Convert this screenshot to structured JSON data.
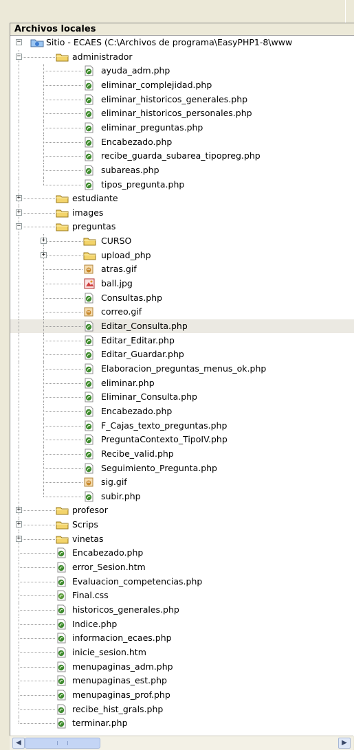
{
  "window": {
    "panel_title": "Archivos locales"
  },
  "tree": [
    {
      "label": "Sitio - ECAES (C:\\Archivos de programa\\EasyPHP1-8\\www",
      "type": "site",
      "depth": 0,
      "expander": "minus"
    },
    {
      "label": "administrador",
      "type": "folder",
      "depth": 1,
      "expander": "minus"
    },
    {
      "label": "ayuda_adm.php",
      "type": "php",
      "depth": 2
    },
    {
      "label": "eliminar_complejidad.php",
      "type": "php",
      "depth": 2
    },
    {
      "label": "eliminar_historicos_generales.php",
      "type": "php",
      "depth": 2
    },
    {
      "label": "eliminar_historicos_personales.php",
      "type": "php",
      "depth": 2
    },
    {
      "label": "eliminar_preguntas.php",
      "type": "php",
      "depth": 2
    },
    {
      "label": "Encabezado.php",
      "type": "php",
      "depth": 2
    },
    {
      "label": "recibe_guarda_subarea_tipopreg.php",
      "type": "php",
      "depth": 2
    },
    {
      "label": "subareas.php",
      "type": "php",
      "depth": 2
    },
    {
      "label": "tipos_pregunta.php",
      "type": "php",
      "depth": 2
    },
    {
      "label": "estudiante",
      "type": "folder",
      "depth": 1,
      "expander": "plus"
    },
    {
      "label": "images",
      "type": "folder",
      "depth": 1,
      "expander": "plus"
    },
    {
      "label": "preguntas",
      "type": "folder",
      "depth": 1,
      "expander": "minus"
    },
    {
      "label": "CURSO",
      "type": "folder",
      "depth": 2,
      "expander": "plus"
    },
    {
      "label": "upload_php",
      "type": "folder",
      "depth": 2,
      "expander": "plus"
    },
    {
      "label": "atras.gif",
      "type": "gif",
      "depth": 2
    },
    {
      "label": "ball.jpg",
      "type": "jpg",
      "depth": 2
    },
    {
      "label": "Consultas.php",
      "type": "php",
      "depth": 2
    },
    {
      "label": "correo.gif",
      "type": "gif",
      "depth": 2
    },
    {
      "label": "Editar_Consulta.php",
      "type": "php",
      "depth": 2,
      "selected": true
    },
    {
      "label": "Editar_Editar.php",
      "type": "php",
      "depth": 2
    },
    {
      "label": "Editar_Guardar.php",
      "type": "php",
      "depth": 2
    },
    {
      "label": "Elaboracion_preguntas_menus_ok.php",
      "type": "php",
      "depth": 2
    },
    {
      "label": "eliminar.php",
      "type": "php",
      "depth": 2
    },
    {
      "label": "Eliminar_Consulta.php",
      "type": "php",
      "depth": 2
    },
    {
      "label": "Encabezado.php",
      "type": "php",
      "depth": 2
    },
    {
      "label": "F_Cajas_texto_preguntas.php",
      "type": "php",
      "depth": 2
    },
    {
      "label": "PreguntaContexto_TipoIV.php",
      "type": "php",
      "depth": 2
    },
    {
      "label": "Recibe_valid.php",
      "type": "php",
      "depth": 2
    },
    {
      "label": "Seguimiento_Pregunta.php",
      "type": "php",
      "depth": 2
    },
    {
      "label": "sig.gif",
      "type": "gif",
      "depth": 2
    },
    {
      "label": "subir.php",
      "type": "php",
      "depth": 2
    },
    {
      "label": "profesor",
      "type": "folder",
      "depth": 1,
      "expander": "plus"
    },
    {
      "label": "Scrips",
      "type": "folder",
      "depth": 1,
      "expander": "plus"
    },
    {
      "label": "vinetas",
      "type": "folder",
      "depth": 1,
      "expander": "plus"
    },
    {
      "label": "Encabezado.php",
      "type": "php",
      "depth": 1
    },
    {
      "label": "error_Sesion.htm",
      "type": "php",
      "depth": 1
    },
    {
      "label": "Evaluacion_competencias.php",
      "type": "php",
      "depth": 1
    },
    {
      "label": "Final.css",
      "type": "css",
      "depth": 1
    },
    {
      "label": "historicos_generales.php",
      "type": "php",
      "depth": 1
    },
    {
      "label": "Indice.php",
      "type": "php",
      "depth": 1
    },
    {
      "label": "informacion_ecaes.php",
      "type": "php",
      "depth": 1
    },
    {
      "label": "inicie_sesion.htm",
      "type": "php",
      "depth": 1
    },
    {
      "label": "menupaginas_adm.php",
      "type": "php",
      "depth": 1
    },
    {
      "label": "menupaginas_est.php",
      "type": "php",
      "depth": 1
    },
    {
      "label": "menupaginas_prof.php",
      "type": "php",
      "depth": 1
    },
    {
      "label": "recibe_hist_grals.php",
      "type": "php",
      "depth": 1
    },
    {
      "label": "terminar.php",
      "type": "php",
      "depth": 1
    }
  ],
  "scrollbar": {
    "left_icon": "arrow-left-icon",
    "right_icon": "arrow-right-icon"
  },
  "colors": {
    "folder": "#f3d46b",
    "php_green": "#3d8a2e",
    "selected_row": "#ebe9e2",
    "chrome": "#ece9d8"
  }
}
